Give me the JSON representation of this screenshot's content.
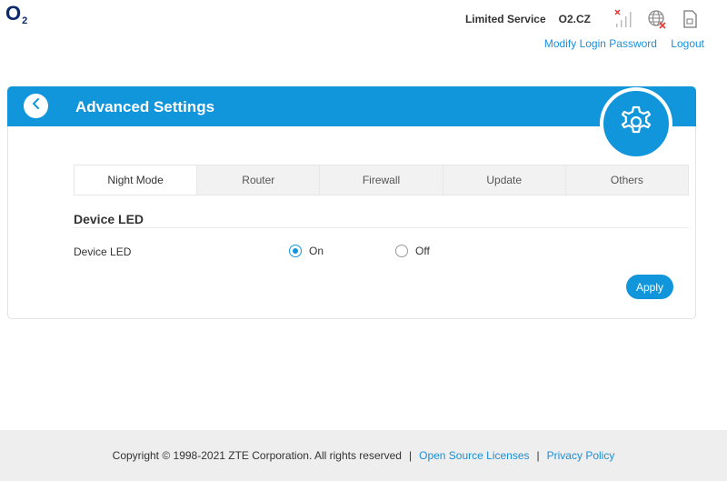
{
  "brand": {
    "logo": "O",
    "logo_sub": "2"
  },
  "status": {
    "service": "Limited Service",
    "carrier": "O2.CZ",
    "icons": [
      "signal-none-icon",
      "globe-disconnected-icon",
      "sim-card-icon"
    ]
  },
  "header_links": {
    "modify_password": "Modify Login Password",
    "logout": "Logout"
  },
  "card": {
    "title": "Advanced Settings",
    "back_icon": "chevron-left-icon",
    "badge_icon": "gear-icon"
  },
  "tabs": [
    {
      "label": "Night Mode",
      "active": true
    },
    {
      "label": "Router",
      "active": false
    },
    {
      "label": "Firewall",
      "active": false
    },
    {
      "label": "Update",
      "active": false
    },
    {
      "label": "Others",
      "active": false
    }
  ],
  "section": {
    "title": "Device LED"
  },
  "device_led": {
    "label": "Device LED",
    "options": [
      {
        "label": "On",
        "selected": true
      },
      {
        "label": "Off",
        "selected": false
      }
    ]
  },
  "apply_label": "Apply",
  "footer": {
    "copyright": "Copyright © 1998-2021 ZTE Corporation. All rights reserved",
    "sep1": "|",
    "open_source": "Open Source Licenses",
    "sep2": "|",
    "privacy": "Privacy Policy"
  },
  "colors": {
    "accent": "#1296db",
    "link": "#1a8fd8",
    "brand": "#0a2a6b"
  }
}
